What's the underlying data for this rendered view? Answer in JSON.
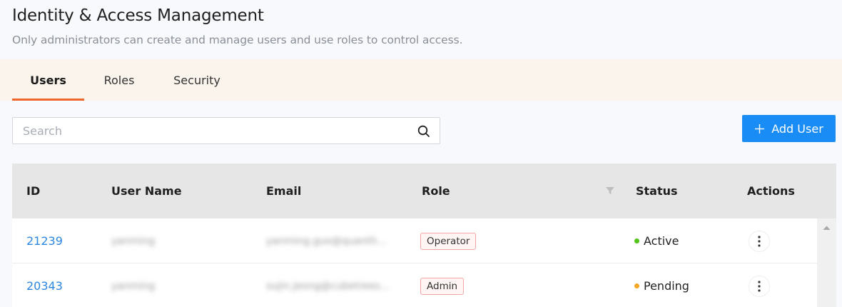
{
  "header": {
    "title": "Identity & Access Management",
    "subtitle": "Only administrators can create and manage users and use roles to control access."
  },
  "tabs": [
    {
      "label": "Users",
      "active": true
    },
    {
      "label": "Roles",
      "active": false
    },
    {
      "label": "Security",
      "active": false
    }
  ],
  "search": {
    "placeholder": "Search",
    "value": ""
  },
  "toolbar": {
    "add_user_label": "Add User"
  },
  "table": {
    "columns": [
      "ID",
      "User Name",
      "Email",
      "Role",
      "Status",
      "Actions"
    ],
    "rows": [
      {
        "id": "21239",
        "username": "yanming",
        "email": "yanming.guo@quanth...",
        "role": "Operator",
        "status": "Active",
        "status_color": "#52c41a"
      },
      {
        "id": "20343",
        "username": "yanming",
        "email": "sujin.jeong@cubetrees...",
        "role": "Admin",
        "status": "Pending",
        "status_color": "#f5a623"
      }
    ]
  },
  "colors": {
    "accent": "#1a8cf5",
    "tab_indicator": "#f0652a",
    "link": "#2b86e0"
  },
  "icons": [
    "search-icon",
    "plus-icon",
    "filter-icon",
    "more-vertical-icon",
    "scroll-up-icon"
  ]
}
